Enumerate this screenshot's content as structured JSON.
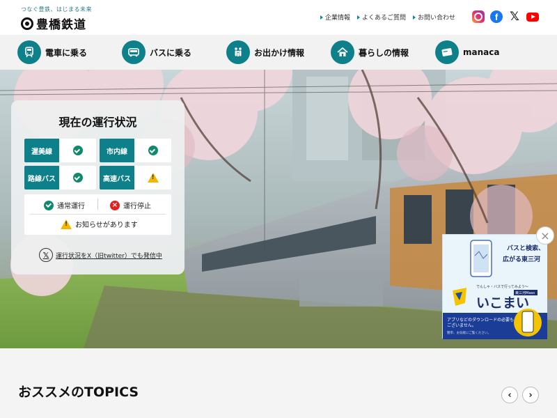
{
  "header": {
    "tagline": "つなぐ豊鉄、はじまる未来",
    "brand": "豊橋鉄道",
    "util_links": [
      "企業情報",
      "よくあるご質問",
      "お問い合わせ"
    ],
    "social": [
      "instagram-icon",
      "facebook-icon",
      "x-icon",
      "youtube-icon"
    ]
  },
  "nav": {
    "items": [
      {
        "label": "電車に乗る",
        "icon": "train-icon"
      },
      {
        "label": "バスに乗る",
        "icon": "bus-icon"
      },
      {
        "label": "お出かけ情報",
        "icon": "family-icon"
      },
      {
        "label": "暮らしの情報",
        "icon": "house-icon"
      },
      {
        "label": "manaca",
        "icon": "card-icon"
      }
    ]
  },
  "status": {
    "title": "現在の運行状況",
    "lines": [
      {
        "name": "渥美線",
        "state": "ok"
      },
      {
        "name": "市内線",
        "state": "ok"
      },
      {
        "name": "路線バス",
        "state": "ok"
      },
      {
        "name": "高速バス",
        "state": "notice"
      }
    ],
    "legend": {
      "normal": "通常運行",
      "stopped": "運行停止",
      "notice": "お知らせがあります"
    },
    "x_link": "運行状況をX（旧twitter）でも発信中"
  },
  "banner": {
    "headline_1": "バスと検索、",
    "headline_2": "広がる東三河",
    "sub": "でんしゃ・バスで行ってみよう〜",
    "badge": "東三河Maas",
    "app_name": "いこまい",
    "footer_1": "アプリなどのダウンロードの必要も",
    "footer_2": "ございません。",
    "footer_3": "簡単、お気軽にご覧ください。"
  },
  "topics": {
    "title": "おススメのTOPICS",
    "prev": "‹",
    "next": "›"
  },
  "colors": {
    "brand_teal": "#0e8089",
    "ok_green": "#108a6c",
    "stop_red": "#dd2222",
    "warn_yellow": "#f2b500"
  }
}
